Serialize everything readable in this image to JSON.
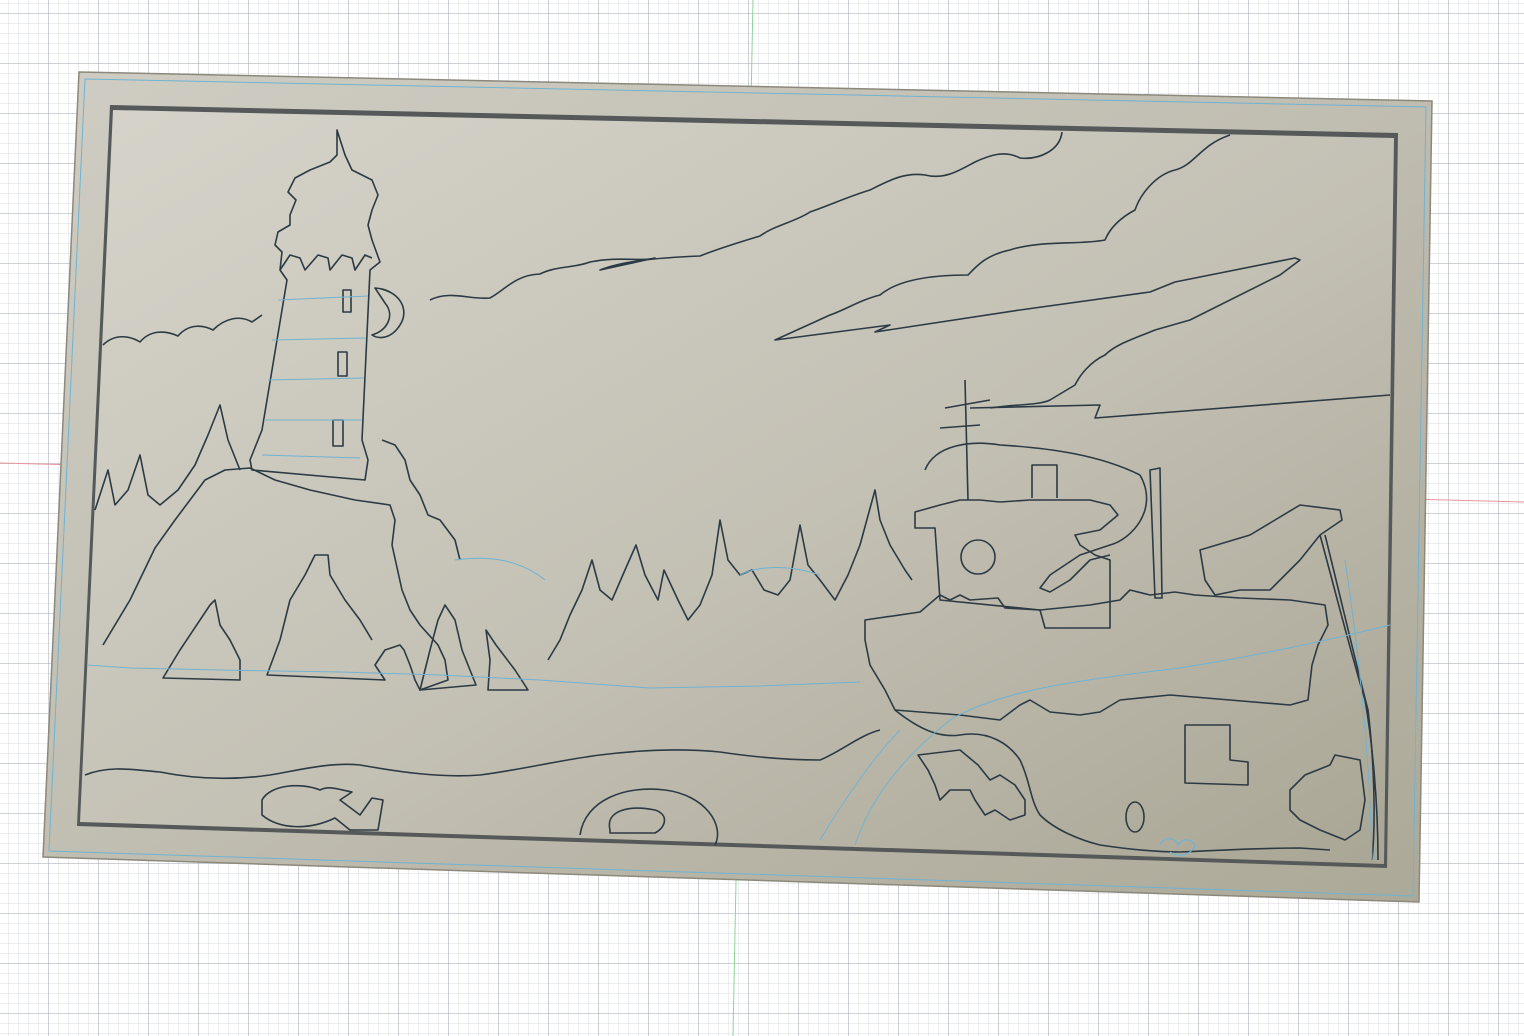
{
  "app": {
    "view": "3d-modeling-viewport"
  },
  "model": {
    "name": ""
  },
  "colors": {
    "grid_minor": "#d4d8dc",
    "grid_major": "#b7bec5",
    "axis_x": "#e8949a",
    "axis_y": "#8ed49a",
    "plate_face": "#bdbaae",
    "plate_edge": "#9c998d",
    "selection_edge": "#6fb3d2",
    "engraving_line": "#2c3a44"
  },
  "icons": [
    "lighthouse",
    "boat",
    "trees",
    "clouds",
    "waves",
    "fish"
  ]
}
